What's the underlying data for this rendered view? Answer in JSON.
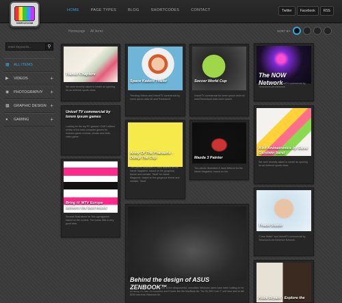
{
  "header": {
    "logo_text": "VIDEOZOOM",
    "nav": [
      "HOME",
      "PAGE TYPES",
      "BLOG",
      "SHORTCODES",
      "CONTACT"
    ],
    "social": [
      "Twitter",
      "Facebook",
      "RSS"
    ]
  },
  "breadcrumb": {
    "home": "Homepage",
    "current": "All items"
  },
  "sort": {
    "label": "SORT BY"
  },
  "search": {
    "placeholder": "enter keywords..."
  },
  "sidebar": {
    "items": [
      {
        "label": "ALL ITEMS",
        "icon": "grid-icon"
      },
      {
        "label": "VIDEOS",
        "icon": "video-icon"
      },
      {
        "label": "PHOTOGRAPHY",
        "icon": "camera-icon"
      },
      {
        "label": "GRAPHIC DESIGN",
        "icon": "palette-icon"
      },
      {
        "label": "GAMING",
        "icon": "gamepad-icon"
      }
    ]
  },
  "cards": [
    {
      "title": "Transit Chapters",
      "desc": "We were recently asked to create an opening for an extreme sports show."
    },
    {
      "title": "Space Kadets Trailer",
      "desc": "Trending Videos and UnicefTV commercial by lorem ipsum dolor sit ameTheseduxit."
    },
    {
      "title": "Soccer World Cup",
      "desc": "UnicefTV commercial for lorem ipsum dolor sit ametTheseduxit dolor lorem ipsum."
    },
    {
      "title": "The NOW Network",
      "desc": "\"Clear Water\" and UnicefTV commercial by Treseduxit.Lite Behence."
    },
    {
      "title": "Unicef TV commercial by lorem ipsum games",
      "desc": "Looking for the top PC games? CNET editors' review of the best computer games for includes game reviews, cheats and hints, video game."
    },
    {
      "title": "Army Of The Pharaohs - Dump The Clip",
      "desc": "Two pieces illustrated & hand lettered for the Name Magazine, based on the gorgeous theme and website. \"Bold\" for Name Magazine, based on the gorgeous theme and website. \"Bold\""
    },
    {
      "title": "Mazda 3 Painter",
      "desc": "Two pieces illustrated & hand lettered for the Name Magazine, based on the."
    },
    {
      "title": "8-bit Animatronics by Steve Gerstwin band",
      "desc": "We were recently asked to create an opening for an extreme sports show."
    },
    {
      "title": "Bring it! MTV Europe delivers the best music",
      "desc": "Several illustrations for MoLogmagazine based on the contest. The books little a very good idea."
    },
    {
      "title": "Behind the design of ASUS ZENBOOK™",
      "desc": "Aside from everything, the UX31 is the ultrapowerful, unrealistic Windows users have been waiting on for all along. It's fast, it's beautiful, and it looks like the MacBook Air. The $1,399 Core i7 unit have sent is still $200 less than Macbook Air."
    },
    {
      "title": "Triada Studio",
      "desc": "\"Clear Water\" and UnicefTV commercial by Treseduxit.Lite Behence Network."
    },
    {
      "title": "Kobe Bryant - Explore the co...",
      "desc": ""
    }
  ],
  "colors": {
    "accent": "#2ea8e0",
    "background": "#3a3a3a",
    "card": "#262626"
  }
}
